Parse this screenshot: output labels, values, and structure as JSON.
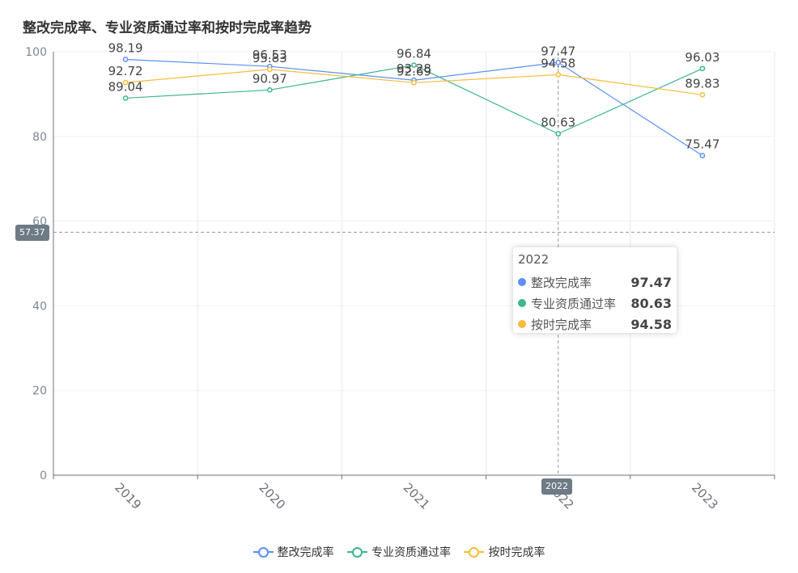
{
  "title": "整改完成率、专业资质通过率和按时完成率趋势",
  "chart_data": {
    "type": "line",
    "title": "整改完成率、专业资质通过率和按时完成率趋势",
    "categories": [
      "2019",
      "2020",
      "2021",
      "2022",
      "2023"
    ],
    "ylim": [
      0,
      100
    ],
    "yticks": [
      0,
      20,
      40,
      60,
      80,
      100
    ],
    "grid": true,
    "legend_position": "bottom",
    "series": [
      {
        "name": "整改完成率",
        "color": "#5b8ff9",
        "values": [
          98.19,
          96.53,
          93.28,
          97.47,
          75.47
        ],
        "labels": [
          "98.19",
          "96.53",
          "93.28",
          "97.47",
          "75.47"
        ]
      },
      {
        "name": "专业资质通过率",
        "color": "#3fb68e",
        "values": [
          89.04,
          90.97,
          96.84,
          80.63,
          96.03
        ],
        "labels": [
          "89.04",
          "90.97",
          "96.84",
          "80.63",
          "96.03"
        ]
      },
      {
        "name": "按时完成率",
        "color": "#f6bd3a",
        "values": [
          92.72,
          95.83,
          92.69,
          94.58,
          89.83
        ],
        "labels": [
          "92.72",
          "95.83",
          "92.69",
          "94.58",
          "89.83"
        ]
      }
    ],
    "crosshair": {
      "y_value": 57.37,
      "y_label": "57.37",
      "x_category": "2022",
      "x_label": "2022"
    }
  },
  "tooltip": {
    "header": "2022",
    "rows": [
      {
        "name": "整改完成率",
        "value": "97.47",
        "color": "#5b8ff9"
      },
      {
        "name": "专业资质通过率",
        "value": "80.63",
        "color": "#3fb68e"
      },
      {
        "name": "按时完成率",
        "value": "94.58",
        "color": "#f6bd3a"
      }
    ]
  },
  "legend": [
    {
      "name": "整改完成率",
      "color": "#5b8ff9"
    },
    {
      "name": "专业资质通过率",
      "color": "#3fb68e"
    },
    {
      "name": "按时完成率",
      "color": "#f6bd3a"
    }
  ]
}
